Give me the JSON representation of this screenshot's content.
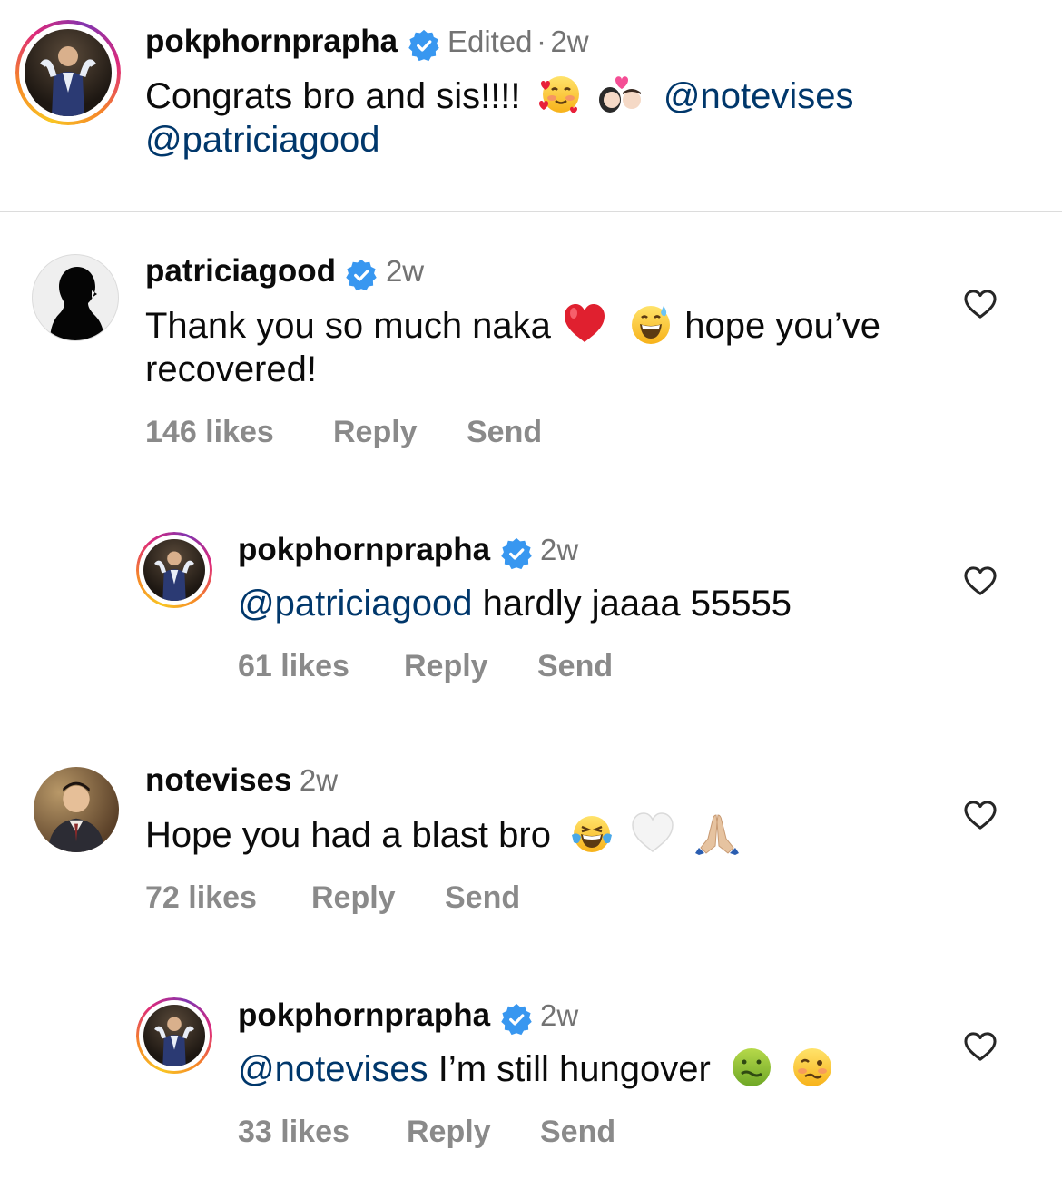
{
  "caption": {
    "username": "pokphornprapha",
    "edited_label": "Edited",
    "separator": "·",
    "time": "2w",
    "text_line1": "Congrats bro and sis!!!!",
    "mention1": "@notevises",
    "mention2": "@patriciagood"
  },
  "comments": [
    {
      "username": "patriciagood",
      "time": "2w",
      "text_line1a": "Thank you so much naka",
      "text_line1b": "hope you’ve",
      "text_line2": "recovered!",
      "likes": "146 likes",
      "reply": "Reply",
      "send": "Send"
    },
    {
      "username": "pokphornprapha",
      "time": "2w",
      "mention": "@patriciagood",
      "text": " hardly jaaaa 55555",
      "likes": "61 likes",
      "reply": "Reply",
      "send": "Send"
    },
    {
      "username": "notevises",
      "time": "2w",
      "text": "Hope you had a blast bro",
      "likes": "72 likes",
      "reply": "Reply",
      "send": "Send"
    },
    {
      "username": "pokphornprapha",
      "time": "2w",
      "mention": "@notevises",
      "text": " I’m still hungover",
      "likes": "33 likes",
      "reply": "Reply",
      "send": "Send"
    }
  ],
  "colors": {
    "mention": "#00376b",
    "verified": "#3897f0",
    "muted": "#737373"
  },
  "icons": [
    "verified-badge-icon",
    "heart-outline-icon"
  ]
}
